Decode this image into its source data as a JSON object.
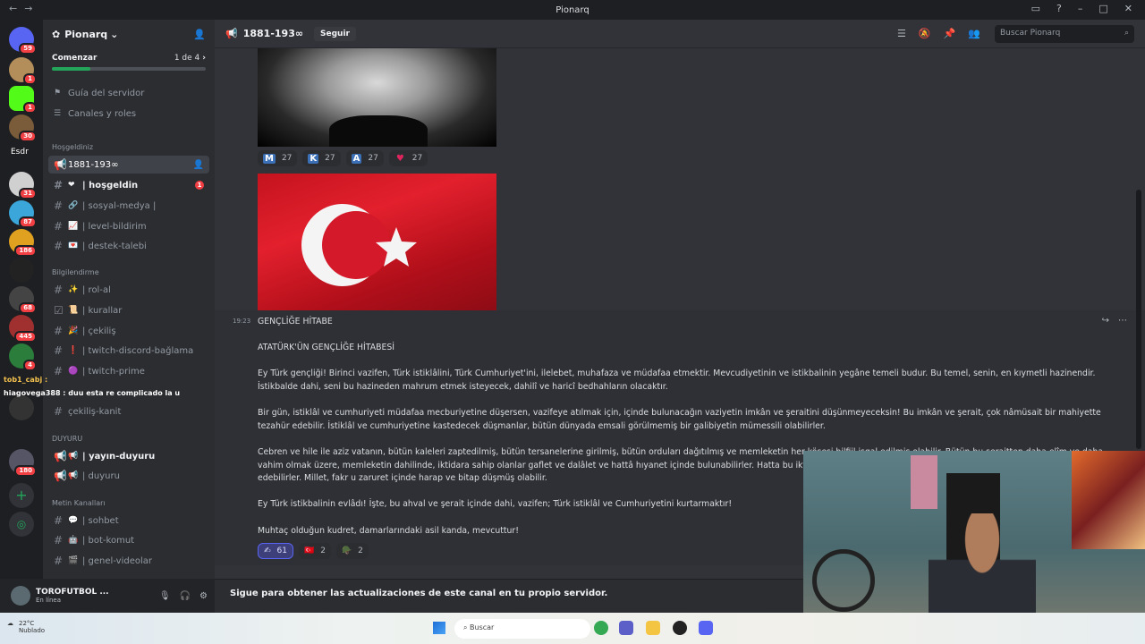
{
  "window": {
    "title": "Pionarq"
  },
  "guild_badges": [
    "59",
    "1",
    "1",
    "30",
    "31",
    "87",
    "186",
    "68",
    "445",
    "4",
    "180"
  ],
  "guild_text": "Esdr",
  "server": {
    "name": "Pionarq",
    "progress": {
      "label": "Comenzar",
      "count": "1 de 4",
      "fraction": 0.25
    },
    "links": [
      {
        "icon": "flag-icon",
        "label": "Guía del servidor"
      },
      {
        "icon": "list-icon",
        "label": "Canales y roles"
      }
    ],
    "categories": [
      "Hoşgeldiniz",
      "Bilgilendirme",
      "DUYURU",
      "Metin Kanalları"
    ],
    "channels": [
      {
        "label": "1881-193∞",
        "kind": "announce",
        "state": "active"
      },
      {
        "label": "| hoşgeldin",
        "emoji": "❤",
        "state": "unread",
        "badge": "1"
      },
      {
        "label": "| sosyal-medya |",
        "emoji": "🔗",
        "state": "normal"
      },
      {
        "label": "| level-bildirim",
        "emoji": "📈",
        "state": "normal"
      },
      {
        "label": "| destek-talebi",
        "emoji": "💌",
        "state": "normal"
      },
      {
        "label": "| rol-al",
        "emoji": "✨",
        "state": "normal"
      },
      {
        "label": "| kurallar",
        "emoji": "📜",
        "state": "normal",
        "kind": "rules"
      },
      {
        "label": "| çekiliş",
        "emoji": "🎉",
        "state": "normal"
      },
      {
        "label": "| twitch-discord-bağlama",
        "emoji": "❗",
        "state": "normal"
      },
      {
        "label": "| twitch-prime",
        "emoji": "🟣",
        "state": "normal"
      },
      {
        "label": "çekiliş-kanit",
        "state": "normal"
      },
      {
        "label": "| yayın-duyuru",
        "emoji": "📢",
        "state": "unread",
        "kind": "announce"
      },
      {
        "label": "| duyuru",
        "emoji": "📢",
        "state": "normal",
        "kind": "announce"
      },
      {
        "label": "| sohbet",
        "emoji": "💬",
        "state": "normal"
      },
      {
        "label": "| bot-komut",
        "emoji": "🤖",
        "state": "normal"
      },
      {
        "label": "| genel-videolar",
        "emoji": "🎬",
        "state": "normal"
      }
    ],
    "chat_overlay": [
      "tob1_cabj :",
      "hiagovega388 : duu esta re complicado la u"
    ]
  },
  "user": {
    "name": "TOROFUTBOL ...",
    "status": "En línea"
  },
  "channel_header": {
    "name": "1881-193∞",
    "follow": "Seguir",
    "search_placeholder": "Buscar Pionarq"
  },
  "reactions_top": [
    {
      "emoji": "M",
      "count": "27",
      "color": "#3b6fb6"
    },
    {
      "emoji": "K",
      "count": "27",
      "color": "#3b6fb6"
    },
    {
      "emoji": "A",
      "count": "27",
      "color": "#3b6fb6"
    },
    {
      "emoji": "♥",
      "count": "27",
      "color": "#e0245e"
    }
  ],
  "message": {
    "time": "19:23",
    "paragraphs": [
      "GENÇLİĞE HİTABE",
      "ATATÜRK'ÜN GENÇLİĞE HİTABESİ",
      "Ey Türk gençliği! Birinci vazifen, Türk istiklâlini, Türk Cumhuriyet'ini, ilelebet, muhafaza ve müdafaa etmektir. Mevcudiyetinin ve istikbalinin yegâne temeli budur. Bu temel, senin, en kıymetli hazinendir. İstikbalde dahi, seni bu hazineden mahrum etmek isteyecek, dahilî ve haricî bedhahların olacaktır.",
      "Bir gün, istiklâl ve cumhuriyeti müdafaa mecburiyetine düşersen, vazifeye atılmak için, içinde bulunacağın vaziyetin imkân ve şeraitini düşünmeyeceksin! Bu imkân ve şerait, çok nâmüsait bir mahiyette tezahür edebilir. İstiklâl ve cumhuriyetine kastedecek düşmanlar, bütün dünyada emsali görülmemiş bir galibiyetin mümessili olabilirler.",
      "Cebren ve hile ile aziz vatanın, bütün kaleleri zaptedilmiş, bütün tersanelerine girilmiş, bütün orduları dağıtılmış ve memleketin her köşesi bilfiil işgal edilmiş olabilir. Bütün bu şeraitten daha elîm ve daha vahim olmak üzere, memleketin dahilinde, iktidara sahip olanlar gaflet ve dalâlet ve hattâ hıyanet içinde bulunabilirler. Hatta bu iktidar sahipleri şahsi menfaatlerini müstevlilerin siyasi emelleriyle tevhit edebilirler. Millet, fakr u zaruret içinde harap ve bitap düşmüş olabilir.",
      "Ey Türk istikbalinin evlâdı! İşte, bu ahval ve şerait içinde dahi, vazifen; Türk istiklâl ve Cumhuriyetini kurtarmaktır!",
      "Muhtaç olduğun kudret, damarlarındaki asil kanda, mevcuttur!"
    ],
    "reactions": [
      {
        "emoji": "✍",
        "count": "61",
        "me": true
      },
      {
        "emoji": "🇹🇷",
        "count": "2",
        "me": false
      },
      {
        "emoji": "🪖",
        "count": "2",
        "me": false
      }
    ]
  },
  "footer": {
    "text": "Sigue para obtener las actualizaciones de este canal en tu propio servidor."
  },
  "taskbar": {
    "temp": "22°C",
    "weather": "Nublado",
    "search": "Buscar"
  }
}
